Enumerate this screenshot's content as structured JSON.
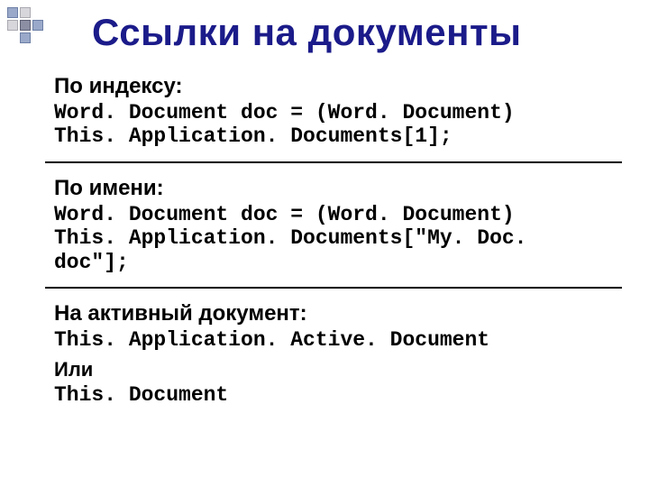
{
  "title": "Ссылки на документы",
  "sections": {
    "by_index": {
      "label": "По индексу:",
      "code_line1": "Word. Document doc = (Word. Document)",
      "code_line2": "This. Application. Documents[1];"
    },
    "by_name": {
      "label": "По имени:",
      "code_line1": "Word. Document doc = (Word. Document)",
      "code_line2": "This. Application. Documents[\"My. Doc. doc\"];"
    },
    "active": {
      "label": "На активный документ:",
      "code_line1": "This. Application. Active. Document",
      "or_label": "Или",
      "code_line2": "This. Document"
    }
  }
}
